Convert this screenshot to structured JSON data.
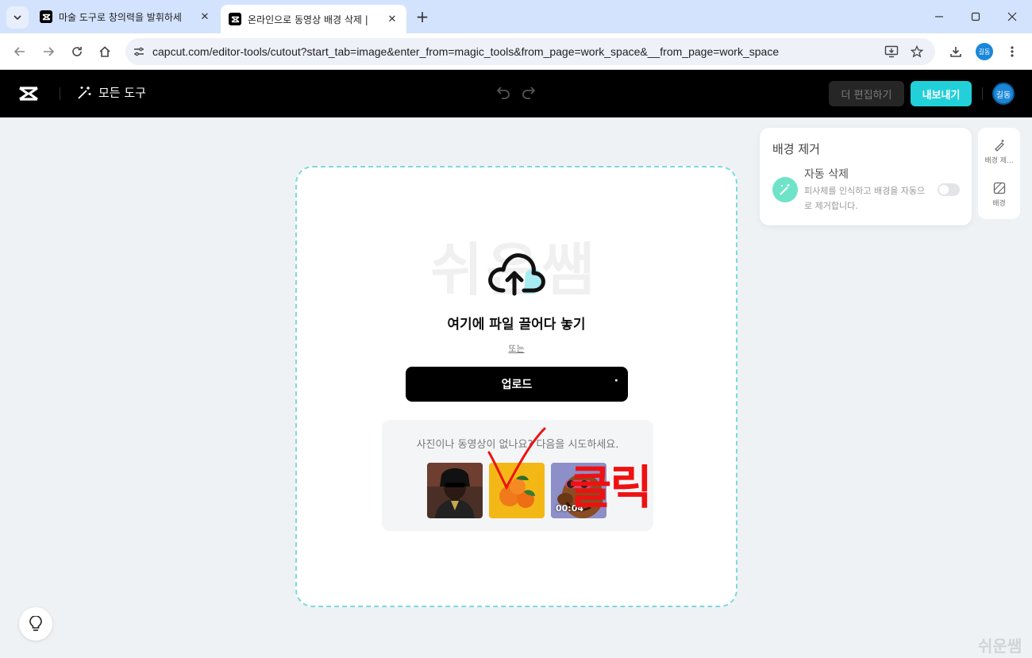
{
  "browser": {
    "tabs": [
      {
        "title": "마술 도구로 창의력을 발휘하세",
        "active": false
      },
      {
        "title": "온라인으로 동영상 배경 삭제 |",
        "active": true
      }
    ],
    "url": "capcut.com/editor-tools/cutout?start_tab=image&enter_from=magic_tools&from_page=work_space&__from_page=work_space",
    "profile_initials": "길동"
  },
  "app": {
    "all_tools_label": "모든 도구",
    "edit_more_label": "더 편집하기",
    "export_label": "내보내기",
    "user_initials": "길동",
    "accent_color": "#21d0d8"
  },
  "dropzone": {
    "watermark": "쉬운쌤",
    "drop_text": "여기에 파일 끌어다 놓기",
    "or_text": "또는",
    "upload_label": "업로드",
    "samples_prompt": "사진이나 동영상이 없나요? 다음을 시도하세요.",
    "samples": [
      {
        "name": "person-sunglasses",
        "duration": ""
      },
      {
        "name": "oranges",
        "duration": ""
      },
      {
        "name": "dog-sunglasses",
        "duration": "00:04"
      }
    ]
  },
  "annotation": {
    "click_text": "클릭"
  },
  "panel": {
    "title": "배경 제거",
    "auto_remove_label": "자동 삭제",
    "auto_remove_desc": "피사체를 인식하고 배경을 자동으로 제거합니다.",
    "toggle_on": false
  },
  "side_tools": [
    {
      "label": "배경 제...",
      "icon": "eraser-icon"
    },
    {
      "label": "배경",
      "icon": "background-icon"
    }
  ],
  "corner_watermark": "쉬운쌤"
}
